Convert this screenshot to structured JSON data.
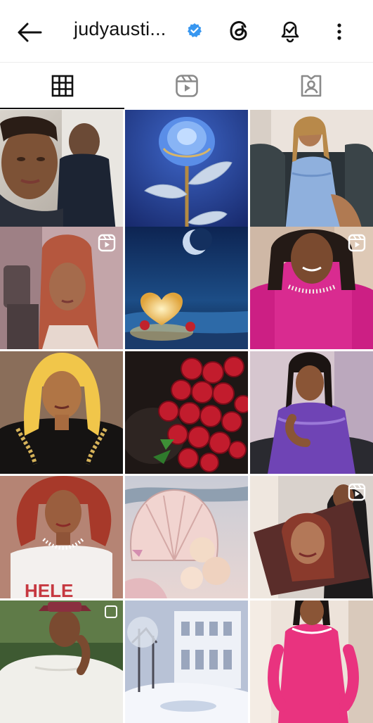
{
  "header": {
    "username": "judyausti...",
    "back_icon": "arrow-left-icon",
    "verified_icon": "verified-badge-icon",
    "threads_icon": "threads-icon",
    "notifications_icon": "bell-check-icon",
    "more_icon": "more-vertical-icon"
  },
  "tabs": [
    {
      "name": "posts",
      "icon": "grid-icon",
      "active": true
    },
    {
      "name": "reels",
      "icon": "reels-icon",
      "active": false
    },
    {
      "name": "tagged",
      "icon": "tagged-person-icon",
      "active": false
    }
  ],
  "posts": [
    {
      "desc": "selfie",
      "reel": false
    },
    {
      "desc": "blue-rose",
      "reel": false
    },
    {
      "desc": "woman-on-sofa",
      "reel": false
    },
    {
      "desc": "woman-in-car",
      "reel": true
    },
    {
      "desc": "glowing-heart-beach",
      "reel": false
    },
    {
      "desc": "woman-pink-top",
      "reel": true
    },
    {
      "desc": "blonde-woman-black-dress",
      "reel": false
    },
    {
      "desc": "red-roses",
      "reel": false
    },
    {
      "desc": "woman-purple-dress",
      "reel": false
    },
    {
      "desc": "woman-red-hair",
      "reel": false
    },
    {
      "desc": "pink-seashells",
      "reel": false
    },
    {
      "desc": "woman-with-portrait",
      "reel": true
    },
    {
      "desc": "man-white-outfit",
      "reel": false
    },
    {
      "desc": "winter-palace",
      "reel": false
    },
    {
      "desc": "woman-pink-dress",
      "reel": false
    }
  ],
  "colors": {
    "accent_verified": "#3897f0",
    "active_tab": "#111111"
  }
}
